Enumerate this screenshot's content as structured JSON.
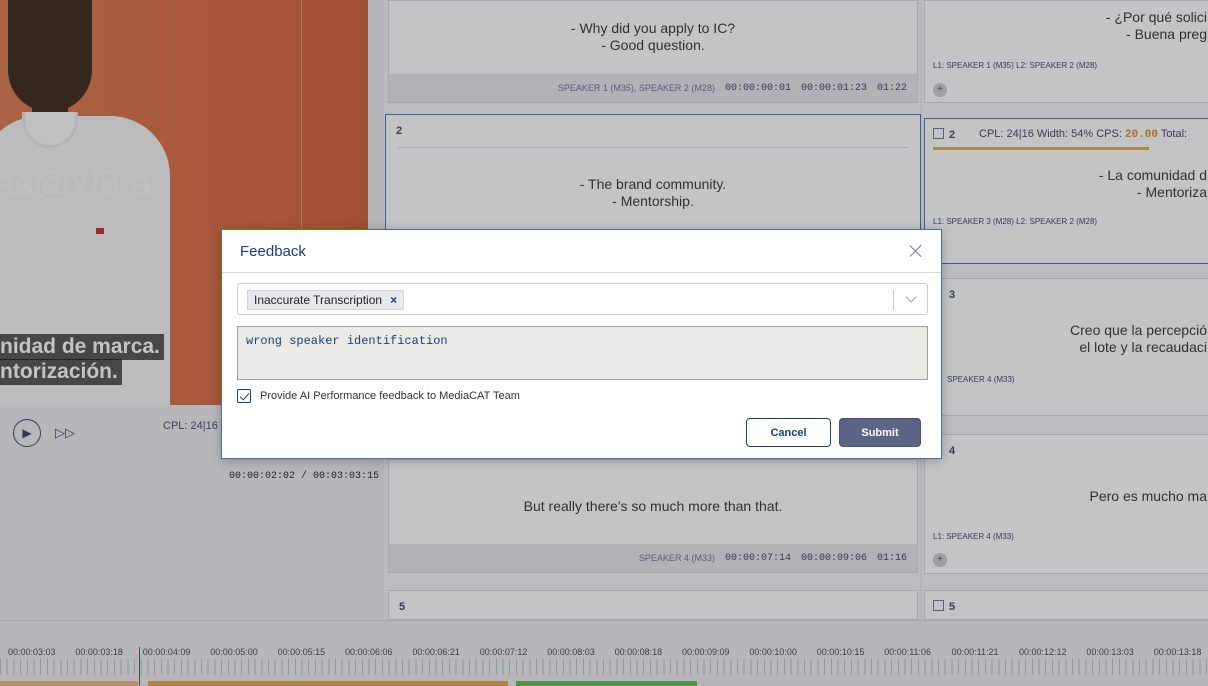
{
  "modal": {
    "title": "Feedback",
    "selected_tag": "Inaccurate Transcription",
    "chip_remove": "×",
    "feedback_text": "wrong speaker identification",
    "checkbox_label": "Provide AI Performance feedback to MediaCAT Team",
    "checkbox_checked": true,
    "cancel_label": "Cancel",
    "submit_label": "Submit"
  },
  "video": {
    "watermark": "as@xl8.a",
    "burned_subtitle_line1": "nidad de marca.",
    "burned_subtitle_line2": "ntorización.",
    "cpl_label": "CPL: 24|16",
    "time_display": "00:00:02:02 / 00:03:03:15"
  },
  "source_cards": [
    {
      "index": "",
      "lines": [
        "- Why did you apply to IC?",
        "- Good question."
      ],
      "speakers": "SPEAKER 1 (M35), SPEAKER 2 (M28)",
      "start": "00:00:00:01",
      "end": "00:00:01:23",
      "duration": "01:22"
    },
    {
      "index": "2",
      "lines": [
        "- The brand community.",
        "- Mentorship."
      ],
      "speakers": "",
      "start": "",
      "end": "",
      "duration": ""
    },
    {
      "index": "",
      "lines": [
        "But really there's so much more than that."
      ],
      "speakers": "SPEAKER 4 (M33)",
      "start": "00:00:07:14",
      "end": "00:00:09:06",
      "duration": "01:16"
    },
    {
      "index": "5",
      "lines": [],
      "speakers": "",
      "start": "",
      "end": "",
      "duration": ""
    }
  ],
  "target_cards": [
    {
      "index": "",
      "line1": "- ¿Por qué solici",
      "line2": "- Buena preg",
      "speakers": "L1: SPEAKER 1 (M35)  L2: SPEAKER 2 (M28)"
    },
    {
      "index": "2",
      "line1": "- La comunidad d",
      "line2": "- Mentoriza",
      "speakers": "L1: SPEAKER 3 (M28)   L2: SPEAKER 2 (M28)",
      "metrics": "CPL: 24|16  Width: 54%  CPS:",
      "cps": "20.00",
      "total": "Total:"
    },
    {
      "index": "3",
      "line1": "Creo que la percepció",
      "line2": "el lote y la recaudaci",
      "speakers": "SPEAKER 4 (M33)"
    },
    {
      "index": "4",
      "line1": "Pero es mucho ma",
      "line2": "",
      "speakers": "L1: SPEAKER 4 (M33)"
    },
    {
      "index": "5",
      "line1": "",
      "line2": "",
      "speakers": ""
    }
  ],
  "timeline": {
    "labels": [
      "00:00:03:03",
      "00:00:03:18",
      "00:00:04:09",
      "00:00:05:00",
      "00:00:05:15",
      "00:00:06:06",
      "00:00:06:21",
      "00:00:07:12",
      "00:00:08:03",
      "00:00:08:18",
      "00:00:09:09",
      "00:00:10:00",
      "00:00:10:15",
      "00:00:11:06",
      "00:00:11:21",
      "00:00:12:12",
      "00:00:13:03",
      "00:00:13:18"
    ]
  },
  "colors": {
    "accent": "#1d3f7a",
    "submit_bg": "#5b6386",
    "video_bg": "#d96a3c",
    "cps_warning": "#e08a1e",
    "segment_orange": "#e8a64a",
    "segment_green": "#5cbf4a"
  }
}
